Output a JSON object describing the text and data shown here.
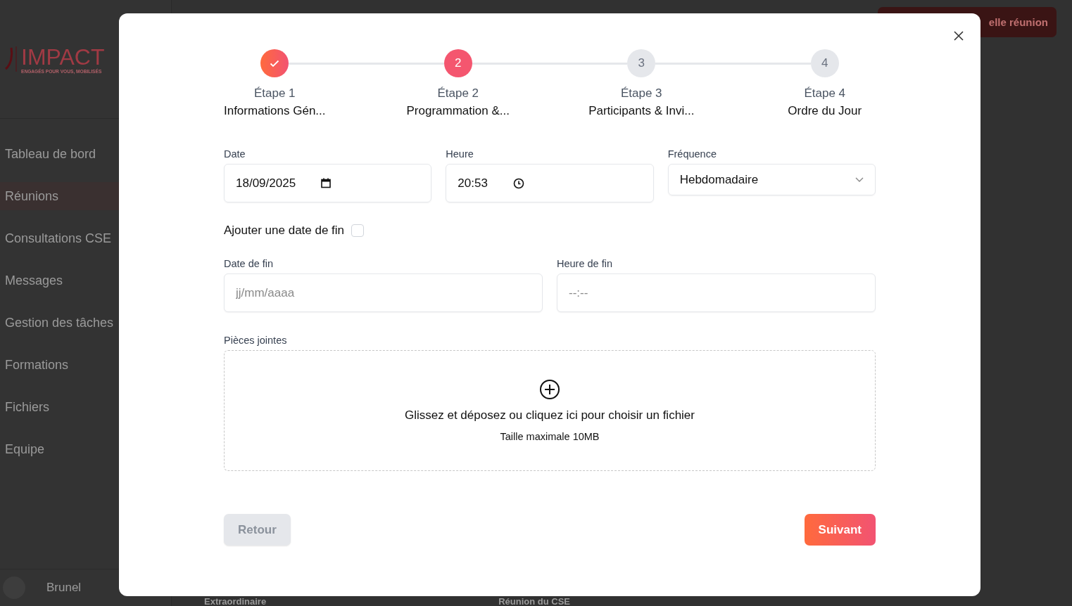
{
  "app": {
    "logo": {
      "name": "IMPACT",
      "tagline": "ENGAGÉS POUR VOUS, MOBILISÉS"
    },
    "sidebar": {
      "items": [
        {
          "label": "Tableau de bord",
          "selected": false
        },
        {
          "label": "Réunions",
          "selected": true
        },
        {
          "label": "Consultations CSE",
          "selected": false
        },
        {
          "label": "Messages",
          "selected": false
        },
        {
          "label": "Gestion des tâches",
          "selected": false
        },
        {
          "label": "Formations",
          "selected": false
        },
        {
          "label": "Fichiers",
          "selected": false
        },
        {
          "label": "Equipe",
          "selected": false
        }
      ],
      "user": {
        "name": "Brunel"
      }
    },
    "header_button": "elle réunion",
    "cards": [
      "Extraordinaire",
      "Réunion du CSE"
    ]
  },
  "dialog": {
    "steps": [
      {
        "title": "Étape 1",
        "label": "Informations Gén...",
        "done": true,
        "current": false
      },
      {
        "title": "Étape 2",
        "label": "Programmation &...",
        "done": false,
        "current": true,
        "number": "2"
      },
      {
        "title": "Étape 3",
        "label": "Participants & Invi...",
        "done": false,
        "current": false,
        "number": "3"
      },
      {
        "title": "Étape 4",
        "label": "Ordre du Jour",
        "done": false,
        "current": false,
        "number": "4"
      }
    ],
    "date": {
      "label": "Date",
      "value": "18/09/2025"
    },
    "time": {
      "label": "Heure",
      "value": "20:53"
    },
    "frequency": {
      "label": "Fréquence",
      "value": "Hebdomadaire"
    },
    "end_date_toggle": {
      "label": "Ajouter une date de fin",
      "checked": false
    },
    "end_date": {
      "label": "Date de fin",
      "placeholder": "jj/mm/aaaa"
    },
    "end_time": {
      "label": "Heure de fin",
      "placeholder": "--:--"
    },
    "attachments": {
      "label": "Pièces jointes",
      "prompt": "Glissez et déposez ou cliquez ici pour choisir un fichier",
      "hint": "Taille maximale 10MB"
    },
    "back_button": {
      "label": "Retour",
      "disabled": true
    },
    "next_button": {
      "label": "Suivant",
      "disabled": false
    }
  }
}
